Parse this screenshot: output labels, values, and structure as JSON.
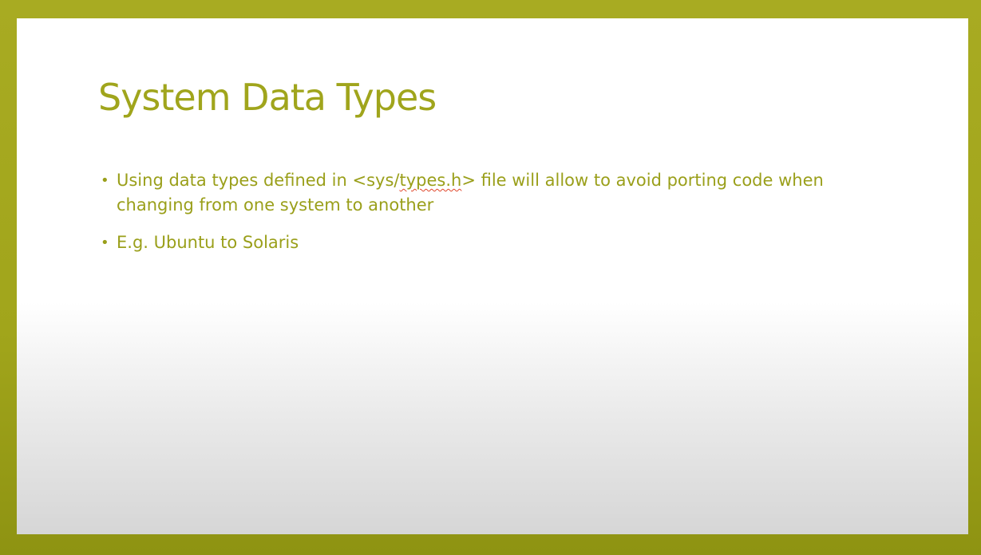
{
  "slide": {
    "title": "System Data Types",
    "bullets": [
      {
        "text_before": "Using data types defined in <sys/",
        "text_marked": "types.h",
        "text_after": "> file will allow to avoid porting code when changing from one system to another"
      },
      {
        "text": "E.g. Ubuntu to Solaris"
      }
    ],
    "bullet_glyph": "•"
  },
  "colors": {
    "frame": "#a4a81c",
    "title": "#a0a51c",
    "body_text": "#9a9f1a",
    "spellcheck_underline": "#e0462a"
  }
}
